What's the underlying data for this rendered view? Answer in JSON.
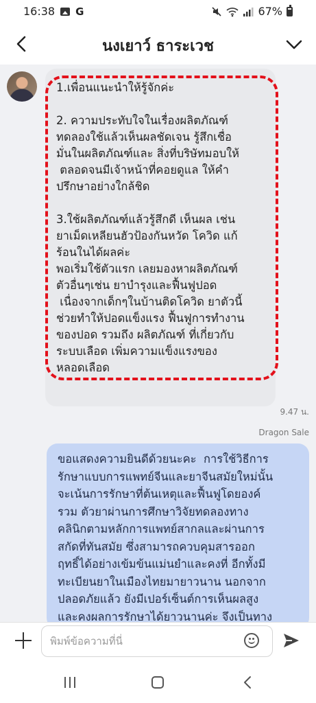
{
  "status_bar": {
    "time": "16:38",
    "left_icons": [
      "image-icon",
      "google-g-icon"
    ],
    "g_label": "G",
    "right_icons": [
      "mute-icon",
      "wifi-icon",
      "signal-icon",
      "battery-icon"
    ],
    "battery": "67%"
  },
  "header": {
    "title": "นงเยาว์ ธาระเวช",
    "back_icon": "chevron-left-icon",
    "menu_icon": "chevron-down-icon"
  },
  "messages": {
    "incoming": {
      "text": "1.เพื่อนแนะนำให้รู้จักค่ะ\n\n2. ความประทับใจในเรื่องผลิตภัณฑ์\nทดลองใช้แล้วเห็นผลชัดเจน รู้สึกเชื่อ\nมั่นในผลิตภัณฑ์และ สิ่งที่บริษัทมอบให้\n ตลอดจนมีเจ้าหน้าที่คอยดูแล ให้คำ\nปรึกษาอย่างใกล้ชิด\n\n3.ใช้ผลิตภัณฑ์แล้วรู้สึกดี เห็นผล เช่น\nยาเม็ดเหลียนฮัวป้องกันหวัด โควิด แก้\nร้อนในได้ผลค่ะ\nพอเริ่มใช้ตัวแรก เลยมองหาผลิตภัณฑ์\nตัวอื่นๆเช่น ยาบำรุงและฟื้นฟูปอด\n เนื่องจากเด็กๆในบ้านติดโควิด ยาตัวนี้\nช่วยทำให้ปอดแข็งแรง ฟื้นฟูการทำงาน\nของปอด รวมถึง ผลิตภัณฑ์ ที่เกี่ยวกับ\nระบบเลือด เพิ่มความแข็งแรงของ\nหลอดเลือด",
      "time": "9.47 น."
    },
    "outgoing": {
      "sender": "Dragon Sale",
      "text": "ขอแสดงความยินดีด้วยนะคะ  การใช้วิธีการ\nรักษาแบบการแพทย์จีนและยาจีนสมัยใหม่นั้น\nจะเน้นการรักษาที่ต้นเหตุและฟื้นฟูโดยองค์\nรวม ตัวยาผ่านการศึกษาวิจัยทดลองทาง\nคลินิกตามหลักการแพทย์สากลและผ่านการ\nสกัดที่ทันสมัย ซึ่งสามารถควบคุมสารออก\nฤทธิ์ได้อย่างเข้มข้นแม่นยำและคงที่ อีกทั้งมี\nทะเบียนยาในเมืองไทยมายาวนาน นอกจาก\nปลอดภัยแล้ว ยังมีเปอร์เซ็นต์การเห็นผลสูง\nและคงผลการรักษาได้ยาวนานค่ะ จึงเป็นทาง"
    }
  },
  "input": {
    "placeholder": "พิมพ์ข้อความที่นี่",
    "value": ""
  },
  "colors": {
    "incoming_bubble": "#e8e9ec",
    "outgoing_bubble": "#c6d6f5",
    "highlight_dash": "#e3111b",
    "chat_background": "#f0f1f4"
  }
}
